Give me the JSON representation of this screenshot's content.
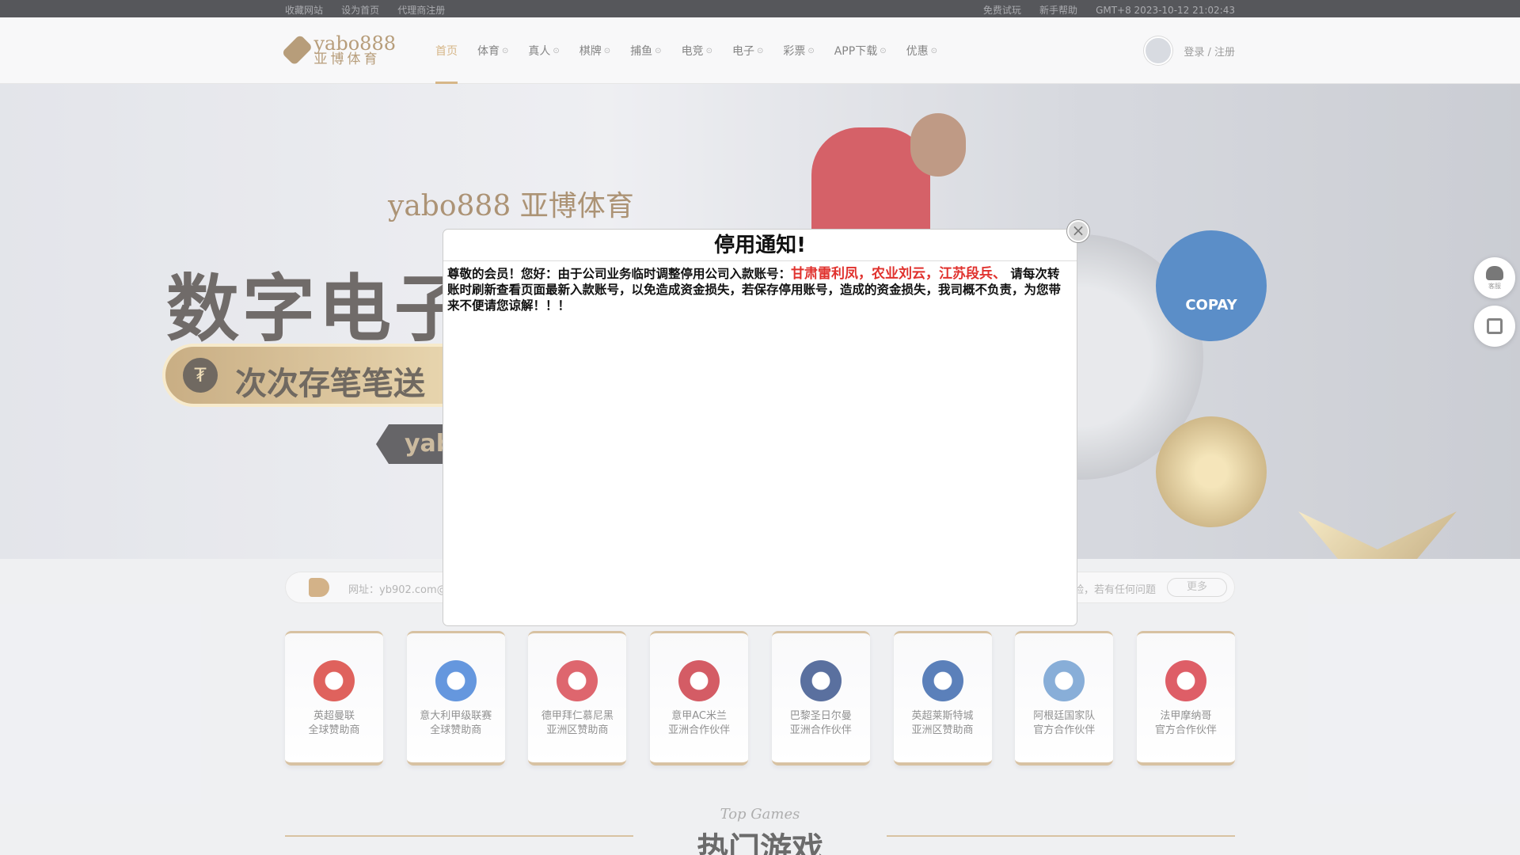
{
  "topbar": {
    "left_links": [
      "收藏网站",
      "设为首页",
      "代理商注册"
    ],
    "right_links": [
      "免费试玩",
      "新手帮助"
    ],
    "time": "GMT+8  2023-10-12 21:02:43"
  },
  "header": {
    "logo_en": "yabo888",
    "logo_cn": "亚博体育",
    "nav": [
      "首页",
      "体育",
      "真人",
      "棋牌",
      "捕鱼",
      "电竞",
      "电子",
      "彩票",
      "APP下载",
      "优惠"
    ],
    "login_label": "登录 / 注册"
  },
  "banner": {
    "logo_en": "yabo888",
    "logo_cn": "亚博体育",
    "headline": "数字电子",
    "pill_text": "次次存笔笔送",
    "cta_text": "yab",
    "copay_text": "COPAY"
  },
  "side": {
    "service_label": "客服"
  },
  "marquee": {
    "left_text": "网址：yb902.com@",
    "right_text": "验，若有任何问题",
    "more_label": "更多"
  },
  "sponsors": [
    {
      "line1": "英超曼联",
      "line2": "全球赞助商",
      "color": "#d3261f"
    },
    {
      "line1": "意大利甲级联赛",
      "line2": "全球赞助商",
      "color": "#2a6fd1"
    },
    {
      "line1": "德甲拜仁慕尼黑",
      "line2": "亚洲区赞助商",
      "color": "#d22b37"
    },
    {
      "line1": "意甲AC米兰",
      "line2": "亚洲合作伙伴",
      "color": "#c41e2a"
    },
    {
      "line1": "巴黎圣日尔曼",
      "line2": "亚洲合作伙伴",
      "color": "#1b3a7a"
    },
    {
      "line1": "英超莱斯特城",
      "line2": "亚洲区赞助商",
      "color": "#1d4fa0"
    },
    {
      "line1": "阿根廷国家队",
      "line2": "官方合作伙伴",
      "color": "#5b8fc9"
    },
    {
      "line1": "法甲摩纳哥",
      "line2": "官方合作伙伴",
      "color": "#d1202d"
    }
  ],
  "hot_games": {
    "en": "Top Games",
    "cn": "热门游戏"
  },
  "modal": {
    "title": "停用通知!",
    "text_before": "尊敬的会员！您好：由于公司业务临时调整停用公司入款账号：",
    "accounts": "甘肃雷利凤，农业刘云，江苏段兵、",
    "text_after": " 请每次转账时刷新查看页面最新入款账号，以免造成资金损失，若保存停用账号，造成的资金损失，我司概不负责，为您带来不便请您谅解！！！",
    "close_glyph": "×"
  },
  "colors": {
    "accent_gold": "#c79a5a",
    "alert_red": "#e0312d",
    "topbar_bg": "#16171c"
  }
}
